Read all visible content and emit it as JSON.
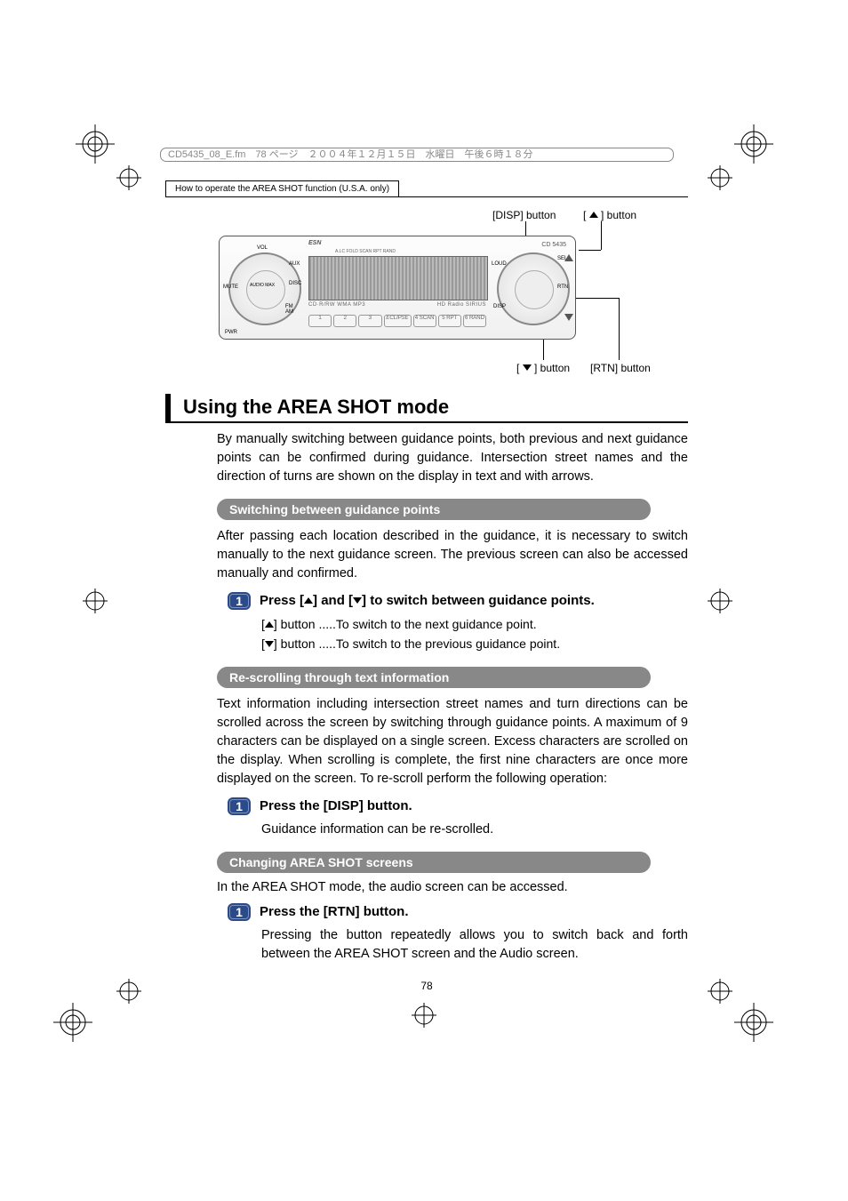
{
  "header_meta": "CD5435_08_E.fm　78 ページ　２００４年１２月１５日　水曜日　午後６時１８分",
  "section_label": "How to operate the AREA SHOT function (U.S.A. only)",
  "figure": {
    "label_disp": "[DISP] button",
    "label_up": "[     ] button",
    "label_down": "[     ] button",
    "label_rtn": "[RTN] button",
    "model": "CD 5435",
    "eclipse": "ECLIPSE",
    "presets": [
      "1",
      "2",
      "3",
      "",
      "4  SCAN",
      "5  RPT",
      "6  RAND"
    ],
    "tiny1": "CD·R/RW WMA MP3",
    "tiny2": "HD Radio  SIRIUS",
    "tiny_top": "A.LC  FOLD  SCAN  RPT  RAND",
    "esn": "ESN",
    "pwr": "PWR",
    "vol": "VOL",
    "mute": "MUTE",
    "disc": "DISC",
    "fmam": "FM\nAM",
    "aux": "AUX",
    "sel": "SEL",
    "disp": "DISP",
    "rtn": "RTN",
    "loud": "LOUD",
    "audiomax": "AUDIO MAX"
  },
  "heading": "Using the AREA SHOT mode",
  "intro": "By manually switching between guidance points, both previous and next guidance points can be confirmed during guidance. Intersection street names and the direction of turns are shown on the display in text and with arrows.",
  "sec1": {
    "title": "Switching between guidance points",
    "para": "After passing each location described in the guidance, it is necessary to switch manually to the next guidance screen. The previous screen can also be accessed manually and confirmed.",
    "step_num": "1",
    "step_text_a": "Press [",
    "step_text_b": "] and [",
    "step_text_c": "] to switch between guidance points.",
    "line_up_a": "[",
    "line_up_b": "] button .....To switch to the next guidance point.",
    "line_down_a": "[",
    "line_down_b": "] button .....To switch to the previous guidance point."
  },
  "sec2": {
    "title": "Re-scrolling through text information",
    "para": "Text information including intersection street names and turn directions can be scrolled across the screen by switching through guidance points. A maximum of 9 characters can be displayed on a single screen. Excess characters are scrolled on the display. When scrolling is complete, the first nine characters are once more displayed on the screen. To re-scroll perform the following operation:",
    "step_num": "1",
    "step_text": "Press the [DISP] button.",
    "followup": "Guidance information can be re-scrolled."
  },
  "sec3": {
    "title": "Changing AREA SHOT screens",
    "intro": "In the AREA SHOT mode, the audio screen can be accessed.",
    "step_num": "1",
    "step_text": "Press the [RTN] button.",
    "followup": "Pressing the button repeatedly allows you to switch back and forth between the AREA SHOT screen and the Audio screen."
  },
  "page_number": "78"
}
